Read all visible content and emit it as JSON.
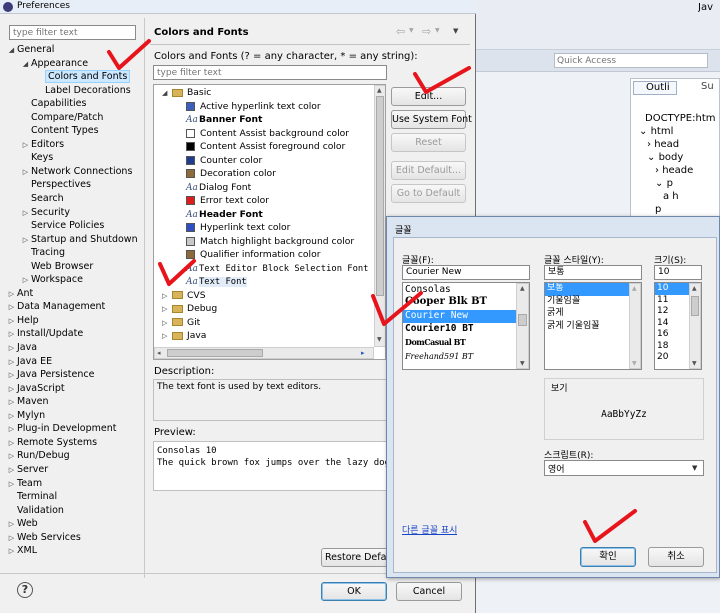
{
  "window": {
    "title": "Preferences"
  },
  "left": {
    "filter_placeholder": "type filter text",
    "tree": [
      {
        "label": "General",
        "indent": 0,
        "exp": "open"
      },
      {
        "label": "Appearance",
        "indent": 1,
        "exp": "open"
      },
      {
        "label": "Colors and Fonts",
        "indent": 2,
        "exp": "",
        "selected": true
      },
      {
        "label": "Label Decorations",
        "indent": 2,
        "exp": ""
      },
      {
        "label": "Capabilities",
        "indent": 1,
        "exp": ""
      },
      {
        "label": "Compare/Patch",
        "indent": 1,
        "exp": ""
      },
      {
        "label": "Content Types",
        "indent": 1,
        "exp": ""
      },
      {
        "label": "Editors",
        "indent": 1,
        "exp": "closed"
      },
      {
        "label": "Keys",
        "indent": 1,
        "exp": ""
      },
      {
        "label": "Network Connections",
        "indent": 1,
        "exp": "closed"
      },
      {
        "label": "Perspectives",
        "indent": 1,
        "exp": ""
      },
      {
        "label": "Search",
        "indent": 1,
        "exp": ""
      },
      {
        "label": "Security",
        "indent": 1,
        "exp": "closed"
      },
      {
        "label": "Service Policies",
        "indent": 1,
        "exp": ""
      },
      {
        "label": "Startup and Shutdown",
        "indent": 1,
        "exp": "closed"
      },
      {
        "label": "Tracing",
        "indent": 1,
        "exp": ""
      },
      {
        "label": "Web Browser",
        "indent": 1,
        "exp": ""
      },
      {
        "label": "Workspace",
        "indent": 1,
        "exp": "closed"
      },
      {
        "label": "Ant",
        "indent": 0,
        "exp": "closed"
      },
      {
        "label": "Data Management",
        "indent": 0,
        "exp": "closed"
      },
      {
        "label": "Help",
        "indent": 0,
        "exp": "closed"
      },
      {
        "label": "Install/Update",
        "indent": 0,
        "exp": "closed"
      },
      {
        "label": "Java",
        "indent": 0,
        "exp": "closed"
      },
      {
        "label": "Java EE",
        "indent": 0,
        "exp": "closed"
      },
      {
        "label": "Java Persistence",
        "indent": 0,
        "exp": "closed"
      },
      {
        "label": "JavaScript",
        "indent": 0,
        "exp": "closed"
      },
      {
        "label": "Maven",
        "indent": 0,
        "exp": "closed"
      },
      {
        "label": "Mylyn",
        "indent": 0,
        "exp": "closed"
      },
      {
        "label": "Plug-in Development",
        "indent": 0,
        "exp": "closed"
      },
      {
        "label": "Remote Systems",
        "indent": 0,
        "exp": "closed"
      },
      {
        "label": "Run/Debug",
        "indent": 0,
        "exp": "closed"
      },
      {
        "label": "Server",
        "indent": 0,
        "exp": "closed"
      },
      {
        "label": "Team",
        "indent": 0,
        "exp": "closed"
      },
      {
        "label": "Terminal",
        "indent": 0,
        "exp": ""
      },
      {
        "label": "Validation",
        "indent": 0,
        "exp": ""
      },
      {
        "label": "Web",
        "indent": 0,
        "exp": "closed"
      },
      {
        "label": "Web Services",
        "indent": 0,
        "exp": "closed"
      },
      {
        "label": "XML",
        "indent": 0,
        "exp": "closed"
      }
    ]
  },
  "page": {
    "title": "Colors and Fonts",
    "subtitle": "Colors and Fonts (? = any character, * = any string):",
    "filter_placeholder": "type filter text",
    "items": [
      {
        "label": "Basic",
        "kind": "folder",
        "indent": 0,
        "exp": "open"
      },
      {
        "label": "Active hyperlink text color",
        "kind": "color",
        "color": "#3b5fbf",
        "indent": 1
      },
      {
        "label": "Banner Font",
        "kind": "font",
        "bold": true,
        "indent": 1
      },
      {
        "label": "Content Assist background color",
        "kind": "color",
        "color": "#ffffff",
        "indent": 1
      },
      {
        "label": "Content Assist foreground color",
        "kind": "color",
        "color": "#000000",
        "indent": 1
      },
      {
        "label": "Counter color",
        "kind": "color",
        "color": "#1f3c8f",
        "indent": 1
      },
      {
        "label": "Decoration color",
        "kind": "color",
        "color": "#8c6a3a",
        "indent": 1
      },
      {
        "label": "Dialog Font",
        "kind": "font",
        "indent": 1
      },
      {
        "label": "Error text color",
        "kind": "color",
        "color": "#e01b1b",
        "indent": 1
      },
      {
        "label": "Header Font",
        "kind": "font",
        "bold": true,
        "indent": 1
      },
      {
        "label": "Hyperlink text color",
        "kind": "color",
        "color": "#2d4fbf",
        "indent": 1
      },
      {
        "label": "Match highlight background color",
        "kind": "color",
        "color": "#c8c8c8",
        "indent": 1
      },
      {
        "label": "Qualifier information color",
        "kind": "color",
        "color": "#8c6a3a",
        "indent": 1
      },
      {
        "label": "Text Editor Block Selection Font",
        "kind": "font",
        "mono": true,
        "indent": 1
      },
      {
        "label": "Text Font",
        "kind": "font",
        "mono": true,
        "indent": 1,
        "selected": true
      },
      {
        "label": "CVS",
        "kind": "folder",
        "indent": 0,
        "exp": "closed"
      },
      {
        "label": "Debug",
        "kind": "folder",
        "indent": 0,
        "exp": "closed"
      },
      {
        "label": "Git",
        "kind": "folder",
        "indent": 0,
        "exp": "closed"
      },
      {
        "label": "Java",
        "kind": "folder",
        "indent": 0,
        "exp": "closed"
      }
    ],
    "buttons": {
      "edit": "Edit...",
      "use_system_font": "Use System Font",
      "reset": "Reset",
      "edit_default": "Edit Default...",
      "go_to_default": "Go to Default",
      "restore_defaults": "Restore Defaults"
    },
    "description_label": "Description:",
    "description_text": "The text font is used by text editors.",
    "preview_label": "Preview:",
    "preview_lines": [
      "Consolas 10",
      "The quick brown fox jumps over the lazy dog"
    ]
  },
  "footer": {
    "ok": "OK",
    "cancel": "Cancel"
  },
  "bg_ide": {
    "quick_access": "Quick Access",
    "tabs": [
      "Outli",
      "Su"
    ],
    "outline": [
      "DOCTYPE:htm",
      "html",
      "head",
      "body",
      "heade",
      "p",
      "a h",
      "p"
    ],
    "java_tab": "Jav"
  },
  "font_dialog": {
    "title": "글꼴",
    "font_label": "글꼴(F):",
    "font_value": "Courier New",
    "fonts": [
      "Consolas",
      "Cooper Blk BT",
      "Courier New",
      "Courier10 BT",
      "DomCasual BT",
      "Freehand591 BT"
    ],
    "style_label": "글꼴 스타일(Y):",
    "style_value": "보통",
    "styles": [
      "보통",
      "기울임꼴",
      "굵게",
      "굵게 기울임꼴"
    ],
    "size_label": "크기(S):",
    "size_value": "10",
    "sizes": [
      "10",
      "11",
      "12",
      "14",
      "16",
      "18",
      "20"
    ],
    "sample_label": "보기",
    "sample_text": "AaBbYyZz",
    "script_label": "스크립트(R):",
    "script_value": "영어",
    "more_fonts_link": "다른 글꼴 표시",
    "ok": "확인",
    "cancel": "취소"
  }
}
